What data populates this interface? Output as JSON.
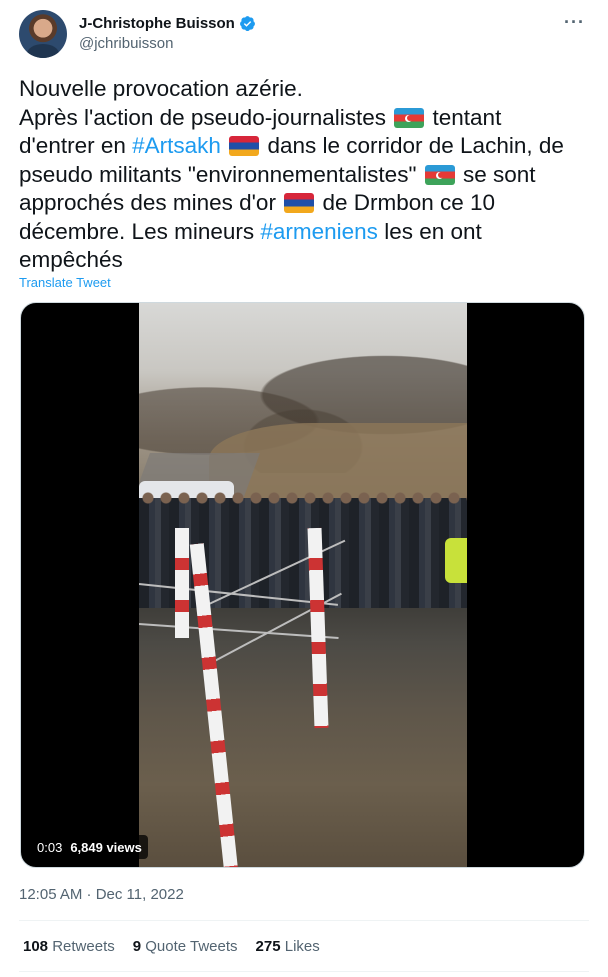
{
  "author": {
    "display_name": "J-Christophe Buisson",
    "handle": "@jchribuisson",
    "verified_icon": "verified-badge-icon",
    "avatar_icon": "avatar"
  },
  "menu": {
    "more_label": "···"
  },
  "tweet": {
    "lines": [
      [
        {
          "t": "Nouvelle provocation azérie."
        }
      ],
      [
        {
          "t": "Après l'action de pseudo-journalistes "
        },
        {
          "flag": "az"
        },
        {
          "t": " tentant"
        }
      ],
      [
        {
          "t": "d'entrer en "
        },
        {
          "tag": "#Artsakh"
        },
        {
          "t": " "
        },
        {
          "flag": "am"
        },
        {
          "t": " dans le corridor de Lachin, de"
        }
      ],
      [
        {
          "t": "pseudo militants \"environnementalistes\" "
        },
        {
          "flag": "az"
        },
        {
          "t": " se sont"
        }
      ],
      [
        {
          "t": "approchés des mines d'or "
        },
        {
          "flag": "am"
        },
        {
          "t": " de Drmbon ce 10"
        }
      ],
      [
        {
          "t": "décembre. Les mineurs "
        },
        {
          "tag": "#armeniens"
        },
        {
          "t": " les en ont"
        }
      ],
      [
        {
          "t": "empêchés"
        }
      ]
    ],
    "translate_label": "Translate Tweet"
  },
  "video": {
    "time": "0:03",
    "views": "6,849 views"
  },
  "meta": {
    "timestamp": "12:05 AM · Dec 11, 2022"
  },
  "stats": [
    {
      "count": "108",
      "label": "Retweets"
    },
    {
      "count": "9",
      "label": "Quote Tweets"
    },
    {
      "count": "275",
      "label": "Likes"
    }
  ],
  "colors": {
    "link": "#1d9bf0",
    "text": "#0f1419",
    "secondary": "#536471"
  }
}
